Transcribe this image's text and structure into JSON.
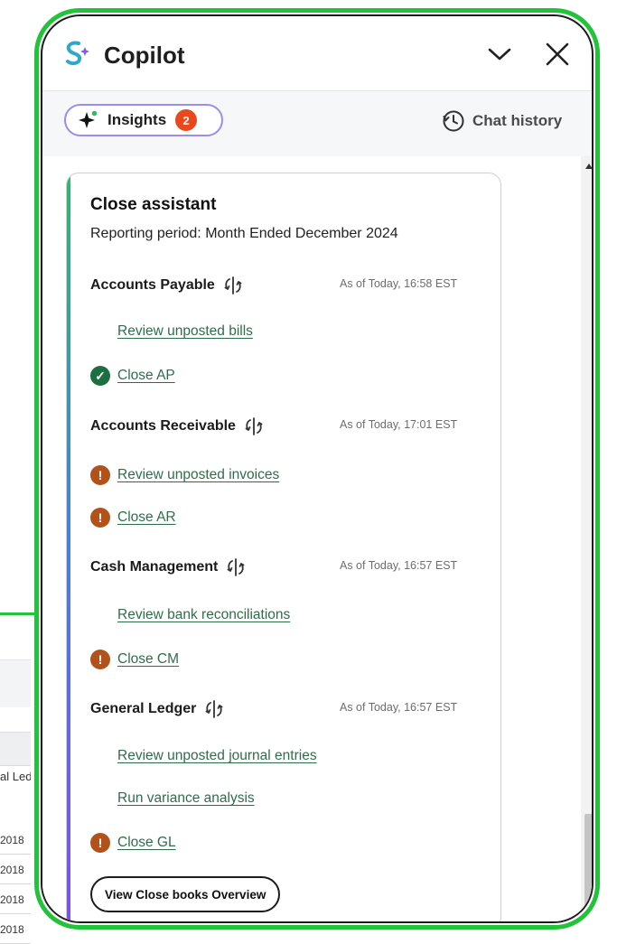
{
  "background": {
    "column_label": "al Led",
    "rows": [
      "2018",
      "2018",
      "2018",
      "2018"
    ]
  },
  "panel": {
    "title": "Copilot",
    "icons": {
      "logo": "copilot-logo-icon",
      "collapse": "chevron-down-icon",
      "close": "close-icon"
    }
  },
  "tabs": {
    "insights_label": "Insights",
    "insights_count": "2",
    "chat_history_label": "Chat history"
  },
  "card": {
    "title": "Close assistant",
    "subtitle": "Reporting period: Month Ended December 2024",
    "sections": [
      {
        "title": "Accounts Payable",
        "timestamp": "As of Today, 16:58 EST",
        "tasks": [
          {
            "label": "Review unposted bills",
            "status": "none"
          },
          {
            "label": "Close AP",
            "status": "complete"
          }
        ]
      },
      {
        "title": "Accounts Receivable",
        "timestamp": "As of Today, 17:01 EST",
        "tasks": [
          {
            "label": "Review unposted invoices",
            "status": "warning"
          },
          {
            "label": "Close AR",
            "status": "warning"
          }
        ]
      },
      {
        "title": "Cash Management",
        "timestamp": "As of Today, 16:57 EST",
        "tasks": [
          {
            "label": "Review bank reconciliations",
            "status": "none"
          },
          {
            "label": "Close CM",
            "status": "warning"
          }
        ]
      },
      {
        "title": "General Ledger",
        "timestamp": "As of Today, 16:57 EST",
        "tasks": [
          {
            "label": "Review unposted journal entries",
            "status": "none"
          },
          {
            "label": "Run variance analysis",
            "status": "none"
          },
          {
            "label": "Close GL",
            "status": "warning"
          }
        ]
      }
    ],
    "overview_button": "View Close books Overview"
  },
  "colors": {
    "highlight_border": "#22c33a",
    "link": "#2f6d4a",
    "status_complete": "#1e6e43",
    "status_warning": "#b0521a",
    "badge": "#e8481c"
  }
}
